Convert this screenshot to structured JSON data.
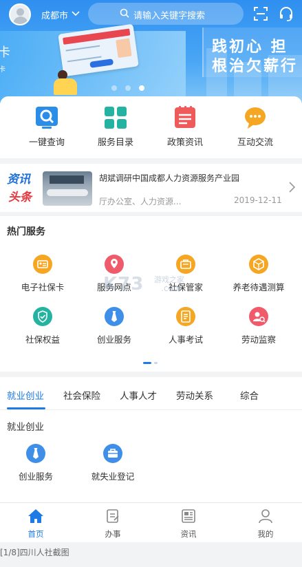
{
  "header": {
    "city": "成都市",
    "search_placeholder": "请输入关键字搜索"
  },
  "banner": {
    "slogan_line1": "践初心 担",
    "slogan_line2": "根治欠薪行",
    "edge_text": "卡",
    "edge_text_small": "卡",
    "active_slide": 3,
    "slide_count": 3
  },
  "quick": [
    {
      "label": "一键查询",
      "icon": "search-icon",
      "color": "#2a8ee8"
    },
    {
      "label": "服务目录",
      "icon": "grid-icon",
      "color": "#23b3a0"
    },
    {
      "label": "政策资讯",
      "icon": "document-icon",
      "color": "#ef5b5b"
    },
    {
      "label": "互动交流",
      "icon": "chat-icon",
      "color": "#f5a623"
    }
  ],
  "news": {
    "badge_line1": "资讯",
    "badge_line2": "头条",
    "title": "胡斌调研中国成都人力资源服务产业园",
    "source": "厅办公室、人力资源...",
    "date": "2019-12-11"
  },
  "hot": {
    "title": "热门服务",
    "items": [
      {
        "label": "电子社保卡",
        "icon": "id-card-icon",
        "color": "#f5a623"
      },
      {
        "label": "服务网点",
        "icon": "location-icon",
        "color": "#ef5b6b"
      },
      {
        "label": "社保管家",
        "icon": "briefcase-icon",
        "color": "#f5a623"
      },
      {
        "label": "养老待遇测算",
        "icon": "cube-icon",
        "color": "#f5a623"
      },
      {
        "label": "社保权益",
        "icon": "shield-icon",
        "color": "#23b3a0"
      },
      {
        "label": "创业服务",
        "icon": "tie-icon",
        "color": "#3f8ee8"
      },
      {
        "label": "人事考试",
        "icon": "exam-icon",
        "color": "#f5a623"
      },
      {
        "label": "劳动监察",
        "icon": "inspect-icon",
        "color": "#ef5b6b"
      }
    ]
  },
  "watermark": {
    "text": "K73",
    "sub": "游戏之家",
    "domain": ".com"
  },
  "categories": {
    "tabs": [
      "就业创业",
      "社会保险",
      "人事人才",
      "劳动关系",
      "综合"
    ],
    "active_tab": "就业创业",
    "section_title": "就业创业",
    "items": [
      {
        "label": "创业服务",
        "icon": "tie-icon"
      },
      {
        "label": "就失业登记",
        "icon": "briefcase-icon"
      }
    ],
    "next_section": "社会保险"
  },
  "bottom_nav": [
    {
      "label": "首页",
      "icon": "home-icon",
      "active": true
    },
    {
      "label": "办事",
      "icon": "task-icon",
      "active": false
    },
    {
      "label": "资讯",
      "icon": "news-icon",
      "active": false
    },
    {
      "label": "我的",
      "icon": "user-icon",
      "active": false
    }
  ],
  "caption": "[1/8]四川人社截图",
  "colors": {
    "accent": "#1e7be6",
    "banner_top": "#2f8ff0"
  }
}
